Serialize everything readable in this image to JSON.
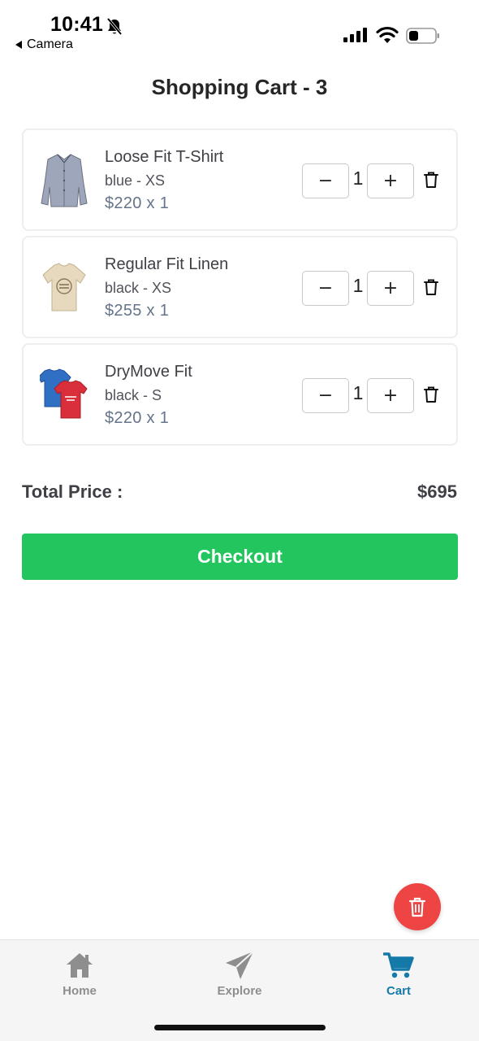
{
  "status_bar": {
    "time": "10:41",
    "back_label": "Camera"
  },
  "header": {
    "title": "Shopping Cart - 3"
  },
  "cart_items": [
    {
      "name": "Loose Fit T-Shirt",
      "variant": "blue - XS",
      "price": "$220 x 1",
      "quantity": "1",
      "image": "grey-button-shirt"
    },
    {
      "name": "Regular Fit Linen",
      "variant": "black - XS",
      "price": "$255 x 1",
      "quantity": "1",
      "image": "beige-graphic-tshirt"
    },
    {
      "name": "DryMove Fit",
      "variant": "black - S",
      "price": "$220 x 1",
      "quantity": "1",
      "image": "blue-red-tshirts"
    }
  ],
  "qty_controls": {
    "minus_label": "−",
    "plus_label": "+"
  },
  "summary": {
    "total_label": "Total Price :",
    "total_value": "$695"
  },
  "checkout": {
    "label": "Checkout"
  },
  "tab_bar": {
    "tabs": [
      {
        "label": "Home",
        "icon": "home-icon",
        "active": false
      },
      {
        "label": "Explore",
        "icon": "send-icon",
        "active": false
      },
      {
        "label": "Cart",
        "icon": "cart-icon",
        "active": true
      }
    ]
  },
  "colors": {
    "checkout_green": "#22c55e",
    "fab_red": "#ef4444",
    "active_tab": "#1479a8",
    "inactive_tab": "#8e8e8e"
  }
}
